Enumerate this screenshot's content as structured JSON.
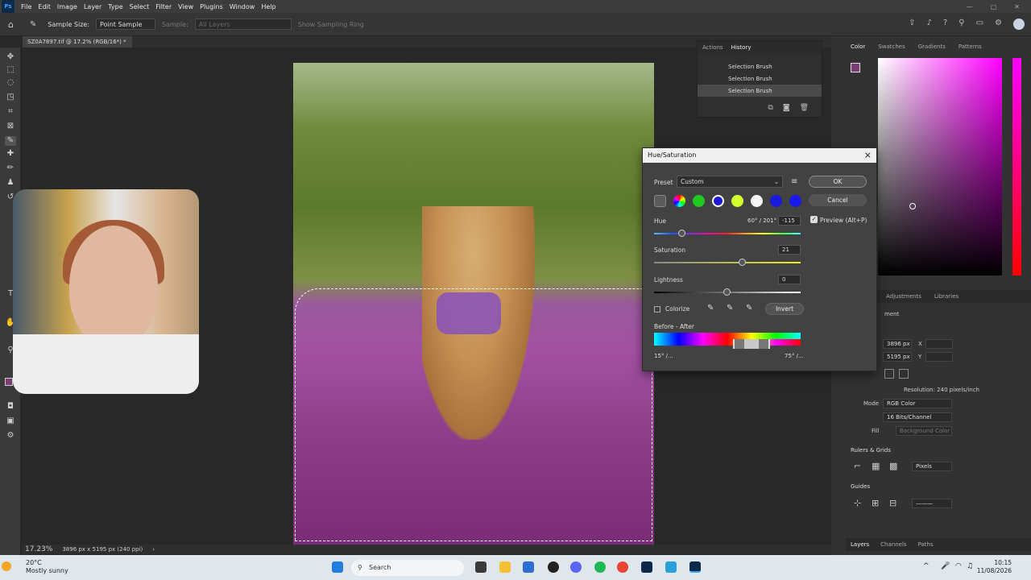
{
  "app": {
    "logo": "Ps",
    "menu": [
      "File",
      "Edit",
      "Image",
      "Layer",
      "Type",
      "Select",
      "Filter",
      "View",
      "Plugins",
      "Window",
      "Help"
    ]
  },
  "options": {
    "sample_size_label": "Sample Size:",
    "sample_size_value": "Point Sample",
    "sample_label": "Sample:",
    "sample_value": "All Layers",
    "show_ring": "Show Sampling Ring"
  },
  "document": {
    "tab_title": "SZ0A7897.tif @ 17.2% (RGB/16*) *",
    "zoom": "17.23%",
    "info": "3896 px x 5195 px (240 ppi)"
  },
  "history": {
    "tabs": [
      "Actions",
      "History"
    ],
    "items": [
      "Selection Brush",
      "Selection Brush",
      "Selection Brush"
    ]
  },
  "color_panel": {
    "tabs": [
      "Color",
      "Swatches",
      "Gradients",
      "Patterns"
    ]
  },
  "properties": {
    "tabs": [
      "Adjustments",
      "Libraries"
    ],
    "doc_label": "ment",
    "width": "3896 px",
    "height": "5195 px",
    "x_label": "X",
    "y_label": "Y",
    "resolution": "Resolution: 240 pixels/inch",
    "mode_label": "Mode",
    "mode_value": "RGB Color",
    "bits_value": "16 Bits/Channel",
    "fill_label": "Fill",
    "fill_value": "Background Color",
    "rulers_header": "Rulers & Grids",
    "units_value": "Pixels",
    "guides_header": "Guides"
  },
  "layers_tabs": [
    "Layers",
    "Channels",
    "Paths"
  ],
  "dialog": {
    "title": "Hue/Saturation",
    "preset_label": "Preset",
    "preset_value": "Custom",
    "ok": "OK",
    "cancel": "Cancel",
    "preview": "Preview (Alt+P)",
    "hue_label": "Hue",
    "hue_range": "60° / 201°",
    "hue_value": "-115",
    "saturation_label": "Saturation",
    "saturation_value": "21",
    "lightness_label": "Lightness",
    "lightness_value": "0",
    "colorize": "Colorize",
    "invert": "Invert",
    "before_after": "Before - After",
    "range_left": "15° /...",
    "range_right": "75° /..."
  },
  "taskbar": {
    "temp": "20°C",
    "weather": "Mostly sunny",
    "search": "Search",
    "time": "10:15",
    "date": "11/08/2026"
  },
  "colors": {
    "accent": "#31a8ff",
    "selection_purple": "#8b55b6"
  }
}
